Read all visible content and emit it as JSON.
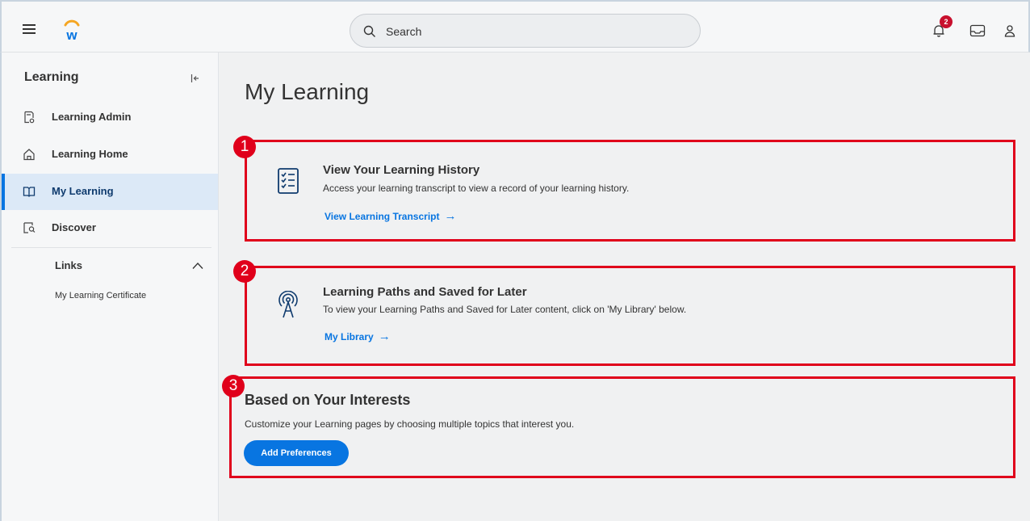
{
  "header": {
    "search_placeholder": "Search",
    "notification_count": "2"
  },
  "sidebar": {
    "title": "Learning",
    "items": [
      {
        "label": "Learning Admin",
        "icon": "report-icon"
      },
      {
        "label": "Learning Home",
        "icon": "home-icon"
      },
      {
        "label": "My Learning",
        "icon": "book-icon",
        "active": true
      },
      {
        "label": "Discover",
        "icon": "discover-icon"
      }
    ],
    "links_header": "Links",
    "links": [
      {
        "label": "My Learning Certificate"
      }
    ]
  },
  "main": {
    "title": "My Learning",
    "cards": [
      {
        "number": "1",
        "title": "View Your Learning History",
        "description": "Access your learning transcript to view a record of your learning history.",
        "link": "View Learning Transcript",
        "icon": "checklist-icon"
      },
      {
        "number": "2",
        "title": "Learning Paths and Saved for Later",
        "description": "To view your Learning Paths and Saved for Later content, click on 'My Library' below.",
        "link": "My Library",
        "icon": "broadcast-tower-icon"
      }
    ],
    "interests": {
      "number": "3",
      "title": "Based on Your Interests",
      "description": "Customize your Learning pages by choosing multiple topics that interest you.",
      "button": "Add Preferences"
    }
  },
  "colors": {
    "accent": "#0875e1",
    "annotation": "#e0001b",
    "active_bg": "#dce9f7"
  }
}
